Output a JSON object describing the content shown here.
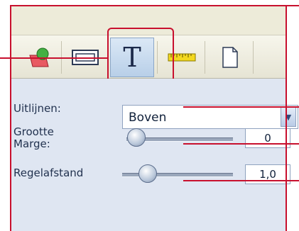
{
  "toolbar": {
    "buttons": [
      {
        "name": "shapes"
      },
      {
        "name": "frame"
      },
      {
        "name": "text",
        "glyph": "T",
        "active": true
      },
      {
        "name": "ruler"
      },
      {
        "name": "page"
      }
    ]
  },
  "properties": {
    "align_label": "Uitlijnen:",
    "align_value": "Boven",
    "size_margin_label_line1": "Grootte",
    "size_margin_label_line2": "Marge:",
    "size_margin_value": "0",
    "size_margin_slider_fraction": 0.0,
    "line_spacing_label": "Regelafstand",
    "line_spacing_value": "1,0",
    "line_spacing_slider_fraction": 0.2
  },
  "colors": {
    "annotation": "#c8102e",
    "panel": "#dfe6f2",
    "toolbar": "#edebd9",
    "active_button": "#b8cfe8"
  }
}
